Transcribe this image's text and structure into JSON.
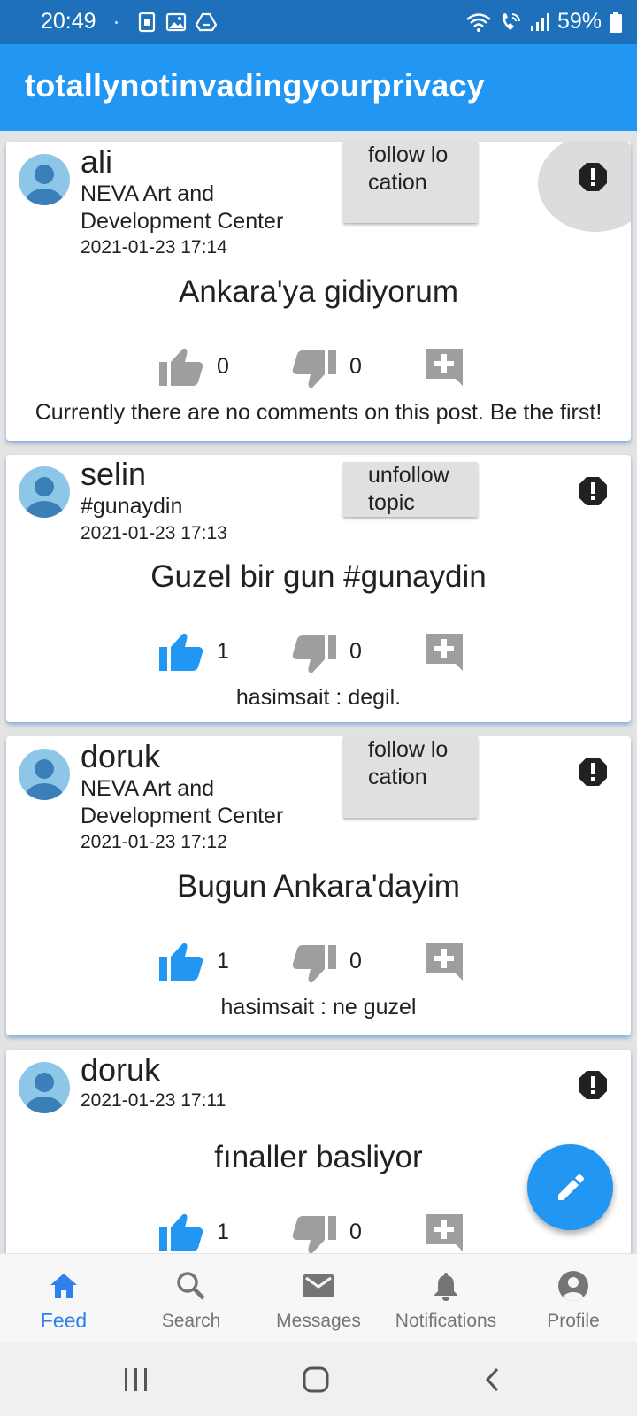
{
  "status_bar": {
    "time": "20:49",
    "battery": "59%",
    "icons": [
      "sim-icon",
      "gallery-icon",
      "drive-icon",
      "wifi-icon",
      "call-icon",
      "signal-icon",
      "battery-icon"
    ]
  },
  "app": {
    "title": "totallynotinvadingyourprivacy",
    "primary_color": "#2196f3",
    "status_color": "#1e70ba"
  },
  "posts": [
    {
      "username": "ali",
      "subtitle": "NEVA Art and Development Center",
      "date": "2021-01-23 17:14",
      "follow_label": "follow location",
      "text": "Ankara'ya gidiyorum",
      "likes": "0",
      "dislikes": "0",
      "liked": false,
      "comment": "Currently there are no comments on this post. Be the first!"
    },
    {
      "username": "selin",
      "subtitle": "#gunaydin",
      "date": "2021-01-23 17:13",
      "follow_label": "unfollow topic",
      "text": "Guzel bir gun #gunaydin",
      "likes": "1",
      "dislikes": "0",
      "liked": true,
      "comment": "hasimsait : degil."
    },
    {
      "username": "doruk",
      "subtitle": "NEVA Art and Development Center",
      "date": "2021-01-23 17:12",
      "follow_label": "follow location",
      "text": "Bugun Ankara'dayim",
      "likes": "1",
      "dislikes": "0",
      "liked": true,
      "comment": "hasimsait : ne guzel"
    },
    {
      "username": "doruk",
      "date": "2021-01-23 17:11",
      "text": "fınaller basliyor",
      "likes": "1",
      "dislikes": "0",
      "liked": true
    }
  ],
  "fab": {
    "icon": "edit-icon"
  },
  "bottom_nav": {
    "active": "Feed",
    "items": [
      {
        "label": "Feed",
        "icon": "home-icon"
      },
      {
        "label": "Search",
        "icon": "search-icon"
      },
      {
        "label": "Messages",
        "icon": "mail-icon"
      },
      {
        "label": "Notifications",
        "icon": "bell-icon"
      },
      {
        "label": "Profile",
        "icon": "account-icon"
      }
    ]
  },
  "colors": {
    "like_active": "#2196f3",
    "icon_inactive": "#9e9e9e",
    "nav_active": "#2f80ed"
  }
}
